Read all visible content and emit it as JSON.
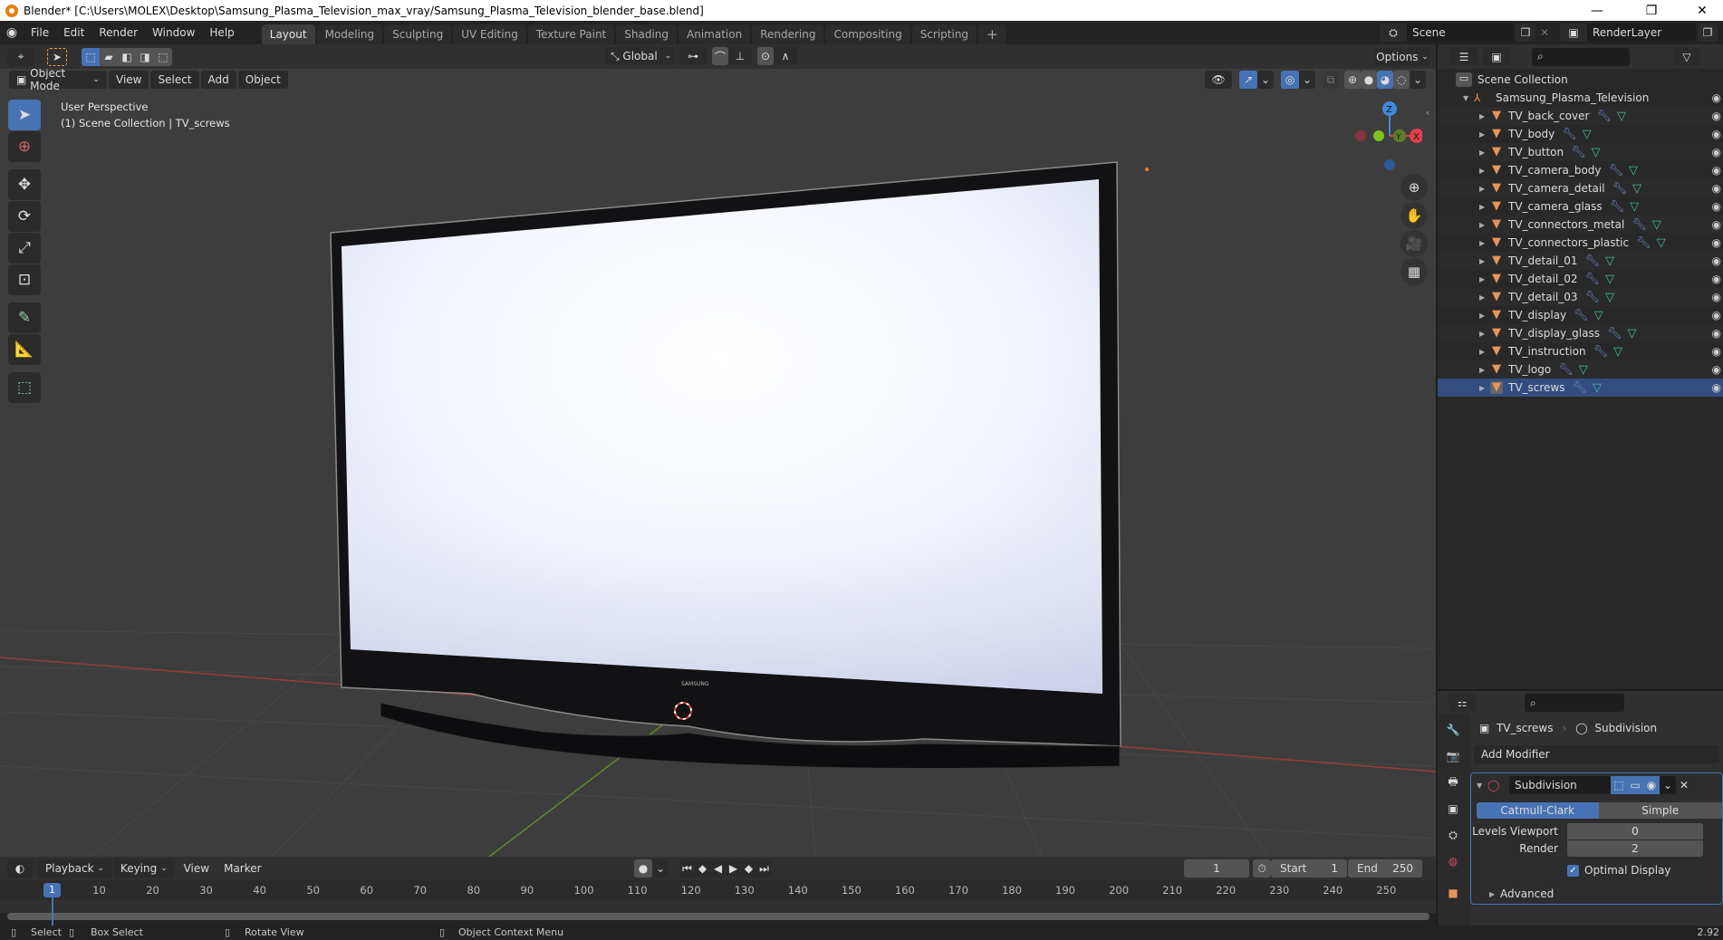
{
  "window": {
    "title": "Blender* [C:\\Users\\MOLEX\\Desktop\\Samsung_Plasma_Television_max_vray/Samsung_Plasma_Television_blender_base.blend]",
    "minimize": "—",
    "maximize": "❐",
    "close": "✕"
  },
  "menu": [
    "File",
    "Edit",
    "Render",
    "Window",
    "Help"
  ],
  "workspaces": [
    {
      "label": "Layout",
      "active": true
    },
    {
      "label": "Modeling"
    },
    {
      "label": "Sculpting"
    },
    {
      "label": "UV Editing"
    },
    {
      "label": "Texture Paint"
    },
    {
      "label": "Shading"
    },
    {
      "label": "Animation"
    },
    {
      "label": "Rendering"
    },
    {
      "label": "Compositing"
    },
    {
      "label": "Scripting"
    }
  ],
  "add_workspace": "+",
  "scene": {
    "name": "Scene",
    "layer": "RenderLayer"
  },
  "tool_header": {
    "orientation": "Global",
    "options": "Options"
  },
  "viewport": {
    "mode": "Object Mode",
    "menus": [
      "View",
      "Select",
      "Add",
      "Object"
    ],
    "overlay_title": "User Perspective",
    "overlay_subtitle": "(1) Scene Collection | TV_screws",
    "gizmo": {
      "z": "Z",
      "y": "Y",
      "x": "X"
    },
    "brand": "SAMSUNG"
  },
  "outliner": {
    "root": "Scene Collection",
    "collection": "Samsung_Plasma_Television",
    "items": [
      "TV_back_cover",
      "TV_body",
      "TV_button",
      "TV_camera_body",
      "TV_camera_detail",
      "TV_camera_glass",
      "TV_connectors_metal",
      "TV_connectors_plastic",
      "TV_detail_01",
      "TV_detail_02",
      "TV_detail_03",
      "TV_display",
      "TV_display_glass",
      "TV_instruction",
      "TV_logo",
      "TV_screws"
    ],
    "active": "TV_screws"
  },
  "properties": {
    "object": "TV_screws",
    "modifier_crumb": "Subdivision",
    "add_modifier": "Add Modifier",
    "modifier_name": "Subdivision",
    "type_options": [
      "Catmull-Clark",
      "Simple"
    ],
    "type_selected": "Catmull-Clark",
    "levels_viewport_label": "Levels Viewport",
    "levels_viewport": "0",
    "render_label": "Render",
    "render": "2",
    "optimal_display_label": "Optimal Display",
    "optimal_display": true,
    "advanced": "Advanced"
  },
  "timeline": {
    "menus": [
      "Playback",
      "Keying",
      "View",
      "Marker"
    ],
    "current_frame": "1",
    "start_label": "Start",
    "start": "1",
    "end_label": "End",
    "end": "250",
    "ticks": [
      "10",
      "20",
      "30",
      "40",
      "50",
      "60",
      "70",
      "80",
      "90",
      "100",
      "110",
      "120",
      "130",
      "140",
      "150",
      "160",
      "170",
      "180",
      "190",
      "200",
      "210",
      "220",
      "230",
      "240",
      "250"
    ],
    "playhead": "1"
  },
  "statusbar": {
    "select": "Select",
    "box_select": "Box Select",
    "rotate_view": "Rotate View",
    "context_menu": "Object Context Menu",
    "version": "2.92"
  }
}
